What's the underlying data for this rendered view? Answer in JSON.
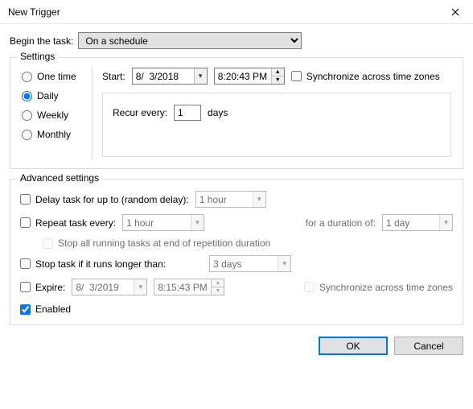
{
  "window": {
    "title": "New Trigger"
  },
  "begin": {
    "label": "Begin the task:",
    "value": "On a schedule"
  },
  "settings": {
    "legend": "Settings",
    "freq": {
      "one_time": "One time",
      "daily": "Daily",
      "weekly": "Weekly",
      "monthly": "Monthly",
      "selected": "daily"
    },
    "start_label": "Start:",
    "date": "8/  3/2018",
    "time": "8:20:43 PM",
    "sync_label": "Synchronize across time zones",
    "recur": {
      "label": "Recur every:",
      "value": "1",
      "unit": "days"
    }
  },
  "advanced": {
    "legend": "Advanced settings",
    "delay": {
      "label": "Delay task for up to (random delay):",
      "value": "1 hour"
    },
    "repeat": {
      "label": "Repeat task every:",
      "value": "1 hour",
      "duration_label": "for a duration of:",
      "duration_value": "1 day"
    },
    "stop_all": {
      "label": "Stop all running tasks at end of repetition duration"
    },
    "stop_if": {
      "label": "Stop task if it runs longer than:",
      "value": "3 days"
    },
    "expire": {
      "label": "Expire:",
      "date": "8/  3/2019",
      "time": "8:15:43 PM",
      "sync_label": "Synchronize across time zones"
    },
    "enabled": {
      "label": "Enabled",
      "checked": true
    }
  },
  "buttons": {
    "ok": "OK",
    "cancel": "Cancel"
  }
}
